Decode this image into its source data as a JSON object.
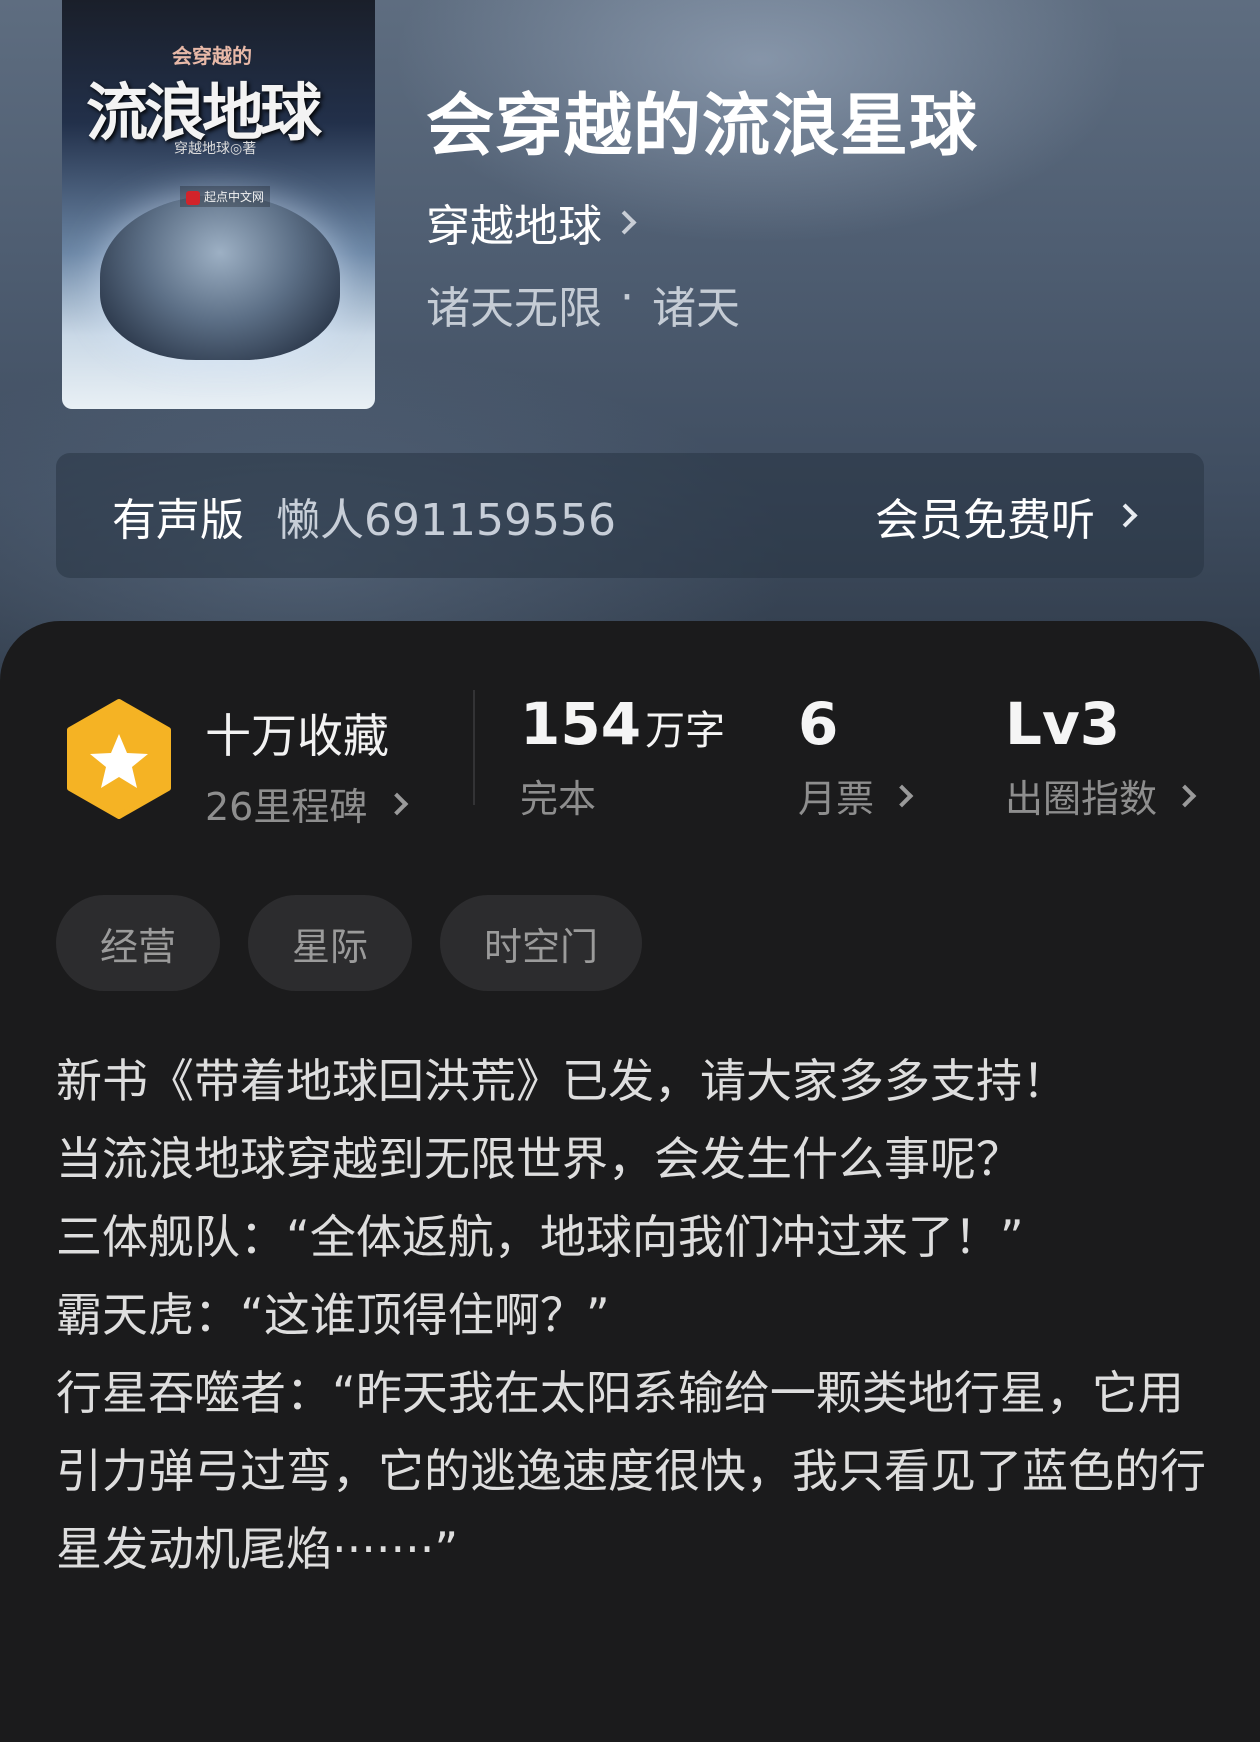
{
  "book": {
    "title": "会穿越的流浪星球",
    "author": "穿越地球",
    "category": "诸天无限",
    "subcategory": "诸天",
    "separator": "·",
    "cover": {
      "small_title": "会穿越的",
      "big_title": "流浪地球",
      "author_line": "穿越地球◎著",
      "brand": "起点中文网"
    }
  },
  "audio": {
    "label": "有声版",
    "narrator": "懒人691159556",
    "action": "会员免费听"
  },
  "stats": {
    "collect_title": "十万收藏",
    "milestones": "26里程碑",
    "words_num": "154",
    "words_unit": "万字",
    "status": "完本",
    "monthly_tickets": "6",
    "monthly_label": "月票",
    "level": "Lv3",
    "level_label": "出圈指数"
  },
  "tags": [
    "经营",
    "星际",
    "时空门"
  ],
  "description": [
    "新书《带着地球回洪荒》已发，请大家多多支持！",
    "当流浪地球穿越到无限世界，会发生什么事呢？",
    "三体舰队：“全体返航，地球向我们冲过来了！”",
    "霸天虎：“这谁顶得住啊？”",
    "行星吞噬者：“昨天我在太阳系输给一颗类地行星，它用引力弹弓过弯，它的逃逸速度很快，我只看见了蓝色的行星发动机尾焰·······”"
  ],
  "colors": {
    "badge": "#f5b324",
    "accent_text": "#ffffff",
    "panel_bg": "#1b1b1c",
    "tag_bg": "#2c2c2e"
  },
  "icons": [
    "chevron-right-icon",
    "star-badge-icon"
  ]
}
